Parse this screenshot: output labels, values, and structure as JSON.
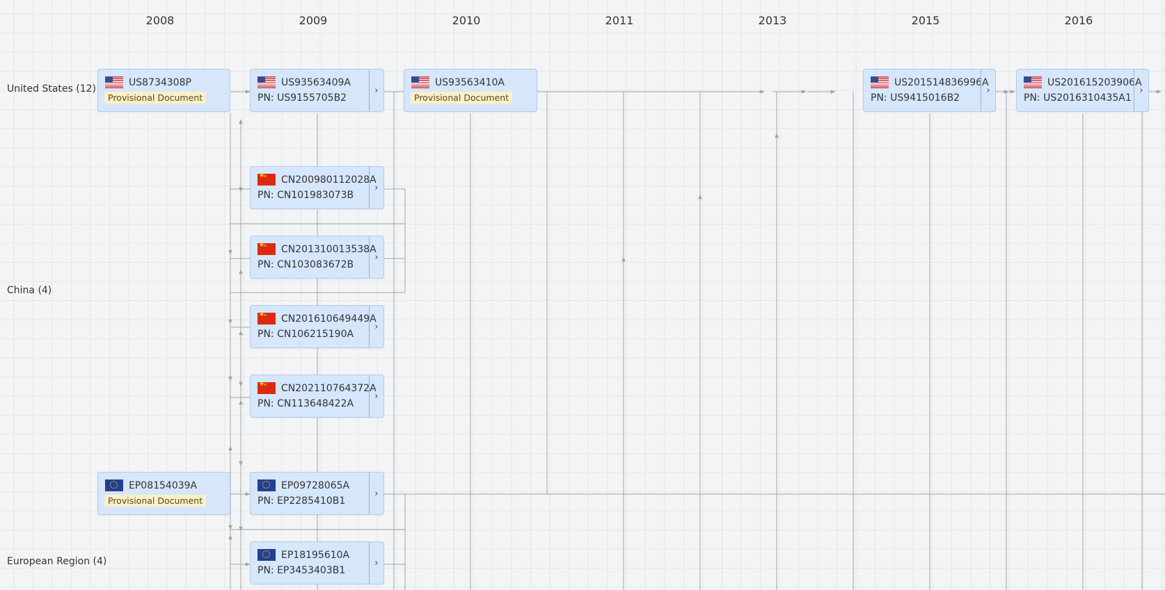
{
  "years": [
    "2008",
    "2009",
    "2010",
    "2011",
    "2013",
    "2015",
    "2016"
  ],
  "rows": {
    "us": "United States (12)",
    "cn": "China (4)",
    "ep": "European Region (4)"
  },
  "cards": [
    {
      "id": "us1",
      "flag": "us-flag-icon",
      "app": "US8734308P",
      "badge": "Provisional Document"
    },
    {
      "id": "us2",
      "flag": "us-flag-icon",
      "app": "US93563409A",
      "pn": "PN: US9155705B2"
    },
    {
      "id": "us3",
      "flag": "us-flag-icon",
      "app": "US93563410A",
      "badge": "Provisional Document"
    },
    {
      "id": "us4",
      "flag": "us-flag-icon",
      "app": "US201514836996A",
      "pn": "PN: US9415016B2"
    },
    {
      "id": "us5",
      "flag": "us-flag-icon",
      "app": "US201615203906A",
      "pn": "PN: US2016310435A1"
    },
    {
      "id": "cn1",
      "flag": "cn-flag-icon",
      "app": "CN200980112028A",
      "pn": "PN: CN101983073B"
    },
    {
      "id": "cn2",
      "flag": "cn-flag-icon",
      "app": "CN201310013538A",
      "pn": "PN: CN103083672B"
    },
    {
      "id": "cn3",
      "flag": "cn-flag-icon",
      "app": "CN201610649449A",
      "pn": "PN: CN106215190A"
    },
    {
      "id": "cn4",
      "flag": "cn-flag-icon",
      "app": "CN202110764372A",
      "pn": "PN: CN113648422A"
    },
    {
      "id": "ep1",
      "flag": "eu-flag-icon",
      "app": "EP08154039A",
      "badge": "Provisional Document"
    },
    {
      "id": "ep2",
      "flag": "eu-flag-icon",
      "app": "EP09728065A",
      "pn": "PN: EP2285410B1"
    },
    {
      "id": "ep3",
      "flag": "eu-flag-icon",
      "app": "EP18195610A",
      "pn": "PN: EP3453403B1"
    }
  ],
  "expand_glyph": "›",
  "colors": {
    "card_bg": "#d6e6fb",
    "card_border": "#b7cbe6",
    "badge_bg": "#fbf0c8",
    "link": "#a3a3a3",
    "grid": "#e4e6ea"
  }
}
